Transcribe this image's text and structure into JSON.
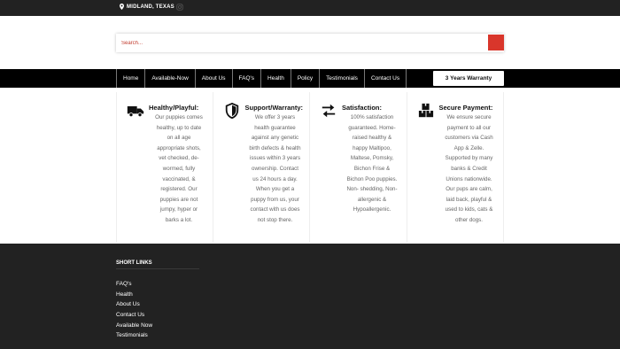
{
  "topbar": {
    "location": "MIDLAND, TEXAS",
    "location_icon": "map-pin-icon",
    "social_icon": "instagram-icon"
  },
  "search": {
    "placeholder": "Search...",
    "button_color": "#d9362b"
  },
  "nav": {
    "items": [
      "Home",
      "Available-Now",
      "About Us",
      "FAQ's",
      "Health",
      "Policy",
      "Testimonials",
      "Contact Us"
    ],
    "cta": "3 Years Warranty"
  },
  "features": [
    {
      "icon": "truck-icon",
      "title": "Healthy/Playful:",
      "lines": [
        "Our puppies comes",
        "healthy, up to date",
        "on all age",
        "appropriate shots,",
        "vet checked, de-",
        "wormed, fully",
        "vaccinated, &",
        "registered. Our",
        "puppies are not",
        "jumpy, hyper or",
        "barks a lot."
      ]
    },
    {
      "icon": "shield-icon",
      "title": "Support/Warranty:",
      "lines": [
        "We offer 3 years",
        "health guarantee",
        "against any genetic",
        "birth defects & health",
        "issues within 3 years",
        "ownership. Contact",
        "us 24 hours a day.",
        "When you get a",
        "puppy from us, your",
        "contact with us does",
        "not stop there."
      ]
    },
    {
      "icon": "exchange-icon",
      "title": "Satisfaction:",
      "lines": [
        "100% satisfaction",
        "guaranteed. Home-",
        "raised healthy &",
        "happy Maltipoo,",
        "Maltese, Pomsky,",
        "Bichon Frise &",
        "Bichon Poo puppies.",
        "Non- shedding, Non-",
        "allergenic &",
        "Hypoallergenic."
      ]
    },
    {
      "icon": "boxes-icon",
      "title": "Secure Payment:",
      "lines": [
        "We ensure secure",
        "payment to all our",
        "customers via Cash",
        "App & Zelle.",
        "Supported by many",
        "banks & Credit",
        "Unions nationwide.",
        "Our pups are calm,",
        "laid back, playful &",
        "used to kids, cats &",
        "other dogs."
      ]
    }
  ],
  "footer": {
    "heading": "SHORT LINKS",
    "links": [
      "FAQ's",
      "Health",
      "About Us",
      "Contact Us",
      "Available Now",
      "Testimonials"
    ]
  }
}
